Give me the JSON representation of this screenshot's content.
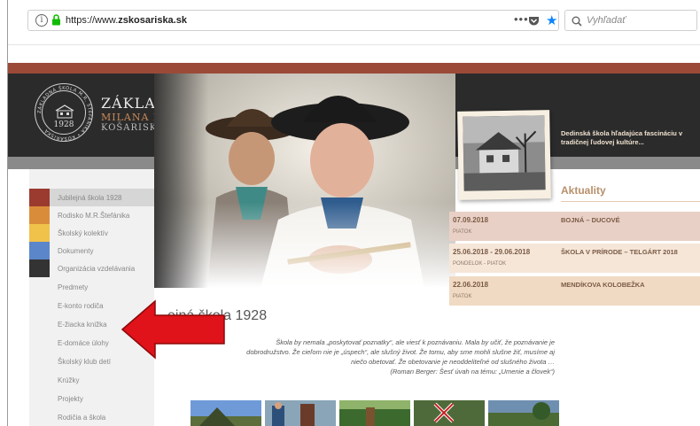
{
  "browser": {
    "url": "https://www.zskosariska.sk",
    "url_prefix": "https://www.",
    "url_domain": "zskosariska.sk",
    "more_label": "•••",
    "search_placeholder": "Vyhľadať"
  },
  "school": {
    "name_line1": "ZÁKLADNÁ ŠKOLA",
    "name_line2": "MILANA RASTISLAVA ŠTEFÁNIKA",
    "name_line3": "KOŠARISKÁ",
    "seal_year": "1928",
    "seal_ring_text": "ZÁKLADNÁ ŠKOLA M.R. ŠTEFÁNIKA • KOŠARISKÁ",
    "tagline": "Dedinská škola hľadajúca fascináciu v tradičnej ľudovej kultúre..."
  },
  "menu": [
    {
      "label": "Jubilejná škola 1928",
      "color": "#9b3a2f",
      "active": true
    },
    {
      "label": "Rodisko M.R.Štefánika",
      "color": "#d98d3a",
      "active": false
    },
    {
      "label": "Školský kolektív",
      "color": "#f0c24a",
      "active": false
    },
    {
      "label": "Dokumenty",
      "color": "#5b86c9",
      "active": false
    },
    {
      "label": "Organizácia vzdelávania",
      "color": "#333333",
      "active": false
    },
    {
      "label": "Predmety",
      "color": "",
      "active": false
    },
    {
      "label": "E-konto rodiča",
      "color": "",
      "active": false
    },
    {
      "label": "E-žiacka knižka",
      "color": "",
      "active": false
    },
    {
      "label": "E-domáce úlohy",
      "color": "",
      "active": false
    },
    {
      "label": "Školský klub detí",
      "color": "",
      "active": false
    },
    {
      "label": "Krúžky",
      "color": "",
      "active": false
    },
    {
      "label": "Projekty",
      "color": "",
      "active": false
    },
    {
      "label": "Rodičia a škola",
      "color": "",
      "active": false
    }
  ],
  "news": {
    "heading": "Aktuality",
    "items": [
      {
        "date": "07.09.2018",
        "day": "PIATOK",
        "title": "BOJNÁ – DUCOVÉ",
        "bg": "#e9d0c6"
      },
      {
        "date": "25.06.2018 - 29.06.2018",
        "day": "PONDELOK - PIATOK",
        "title": "ŠKOLA V PRÍRODE – TELGÁRT 2018",
        "bg": "#f6e6d8"
      },
      {
        "date": "22.06.2018",
        "day": "PIATOK",
        "title": "MENDÍKOVA KOLOBEŽKA",
        "bg": "#f1dac3"
      }
    ]
  },
  "article": {
    "title": "ejná škola 1928",
    "quote_lines": [
      "Škola by nemala „poskytovať poznatky“, ale viesť k poznávaniu. Mala by učiť, že poznávanie je",
      "dobrodružstvo. Že cieľom nie je „úspech“, ale slušný život. Že tomu, aby sme mohli slušne žiť, musíme aj",
      "niečo obetovať. Že obetovanie je neoddeliteľné od slušného života …",
      "(Roman Berger: Šesť úvah na tému: „Umenie a človek“)"
    ]
  },
  "colors": {
    "accent_arrow": "#e0121a",
    "header_bg": "#2b2b2b",
    "top_stripe": "#9b4a38",
    "news_heading": "#b7906b"
  },
  "icons": [
    "info-icon",
    "lock-icon",
    "more-icon",
    "pocket-icon",
    "bookmark-star-icon",
    "search-icon",
    "school-seal-logo",
    "red-arrow-icon"
  ]
}
